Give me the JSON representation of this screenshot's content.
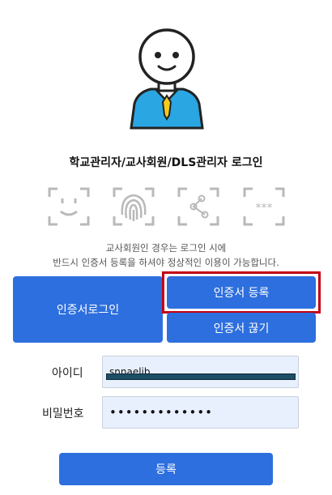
{
  "page": {
    "title": "학교관리자/교사회원/DLS관리자 로그인",
    "notice_line1": "교사회원인 경우는 로그인 시에",
    "notice_line2": "반드시 인증서 등록을 하셔야 정상적인 이용이 가능합니다."
  },
  "auth_methods": [
    "face-scan-icon",
    "fingerprint-icon",
    "pattern-icon",
    "pin-icon"
  ],
  "buttons": {
    "cert_login": "인증서로그인",
    "cert_register": "인증서 등록",
    "cert_disconnect": "인증서 끊기",
    "submit": "등록"
  },
  "form": {
    "id_label": "아이디",
    "id_value": "snnaelib",
    "pw_label": "비밀번호",
    "pw_value": "•••••••••••••"
  },
  "colors": {
    "primary": "#2d6fde",
    "highlight": "#c30012",
    "field_bg": "#e8f0fe"
  }
}
